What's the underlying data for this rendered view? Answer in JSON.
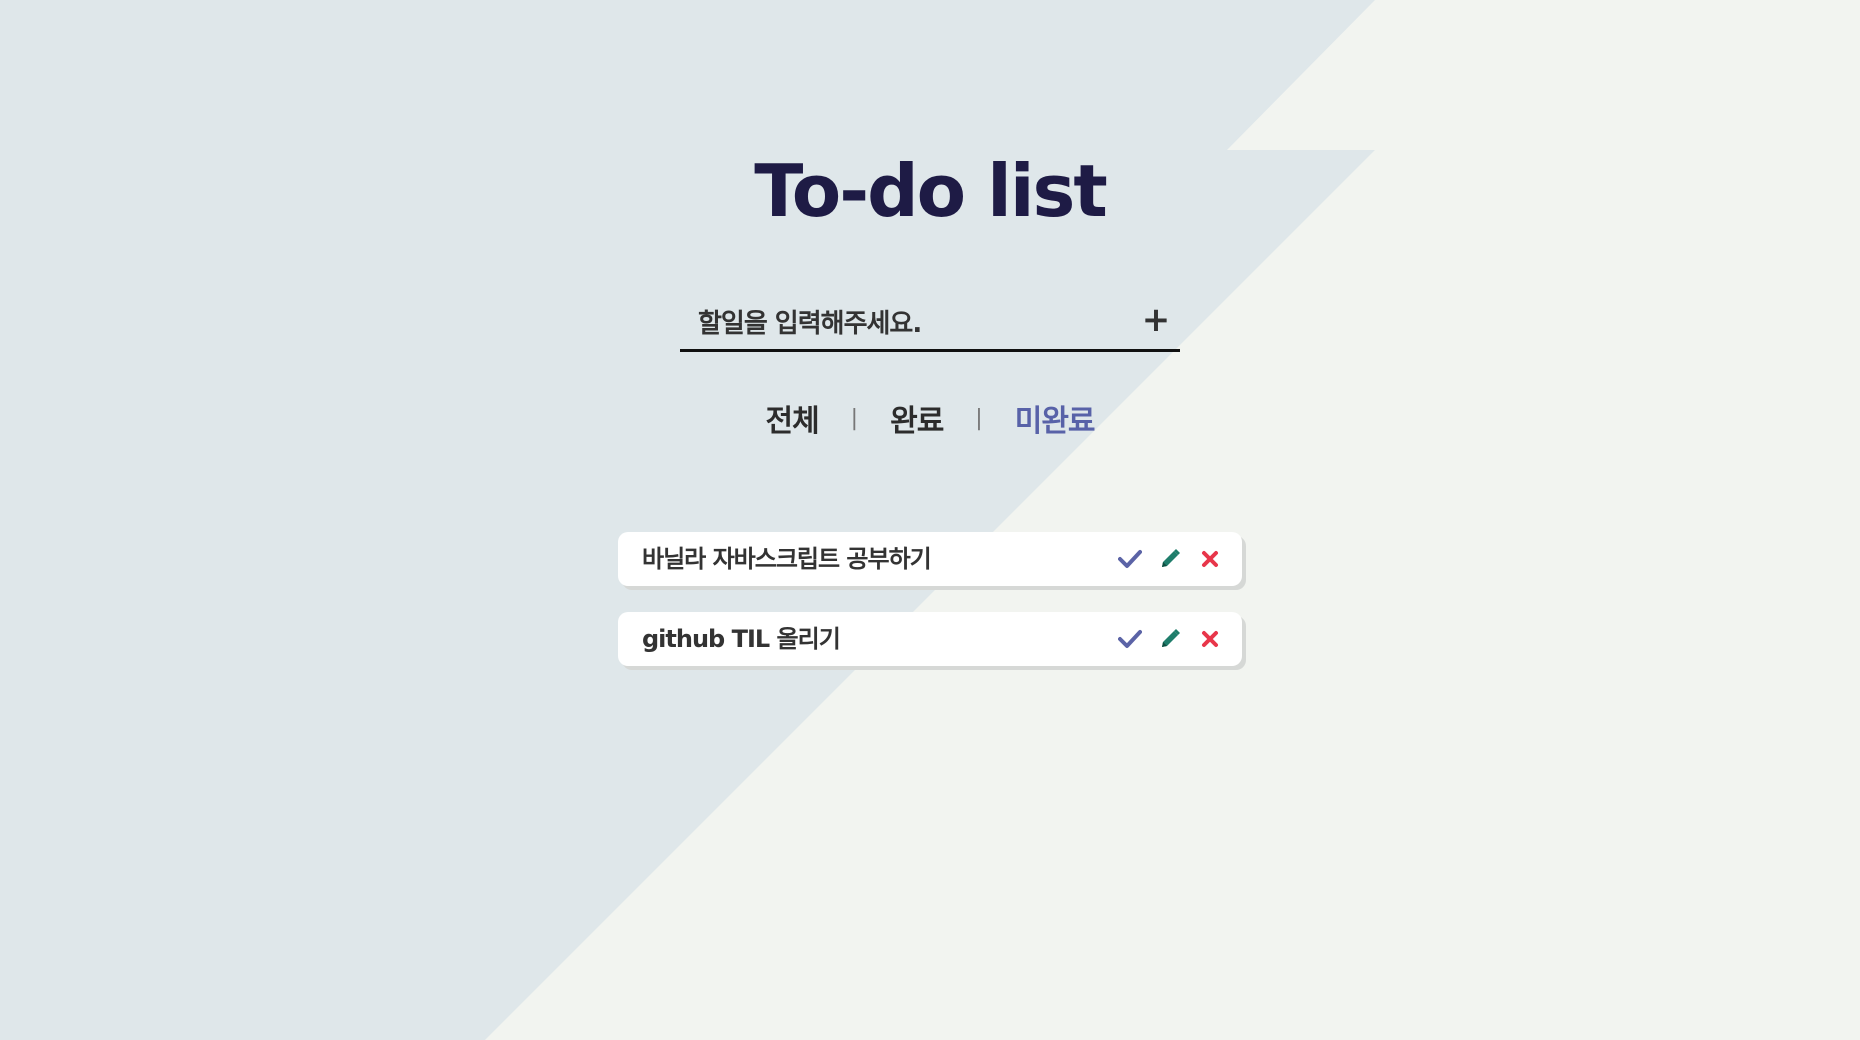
{
  "header": {
    "title": "To-do list"
  },
  "input": {
    "placeholder": "할일을 입력해주세요.",
    "value": "",
    "add_label": "+"
  },
  "filters": {
    "tabs": [
      {
        "label": "전체",
        "active": false
      },
      {
        "label": "완료",
        "active": false
      },
      {
        "label": "미완료",
        "active": true
      }
    ],
    "separator": "|"
  },
  "todos": [
    {
      "text": "바닐라 자바스크립트 공부하기",
      "actions": [
        "check-icon",
        "pencil-icon",
        "close-icon"
      ]
    },
    {
      "text": "github TIL 올리기",
      "actions": [
        "check-icon",
        "pencil-icon",
        "close-icon"
      ]
    }
  ],
  "colors": {
    "background_light": "#f2f4f0",
    "background_shape": "#dfe7ea",
    "title": "#1e1b45",
    "active_filter": "#5862a8",
    "check": "#5b63a6",
    "pencil": "#1f7d6b",
    "delete": "#e8364a"
  }
}
